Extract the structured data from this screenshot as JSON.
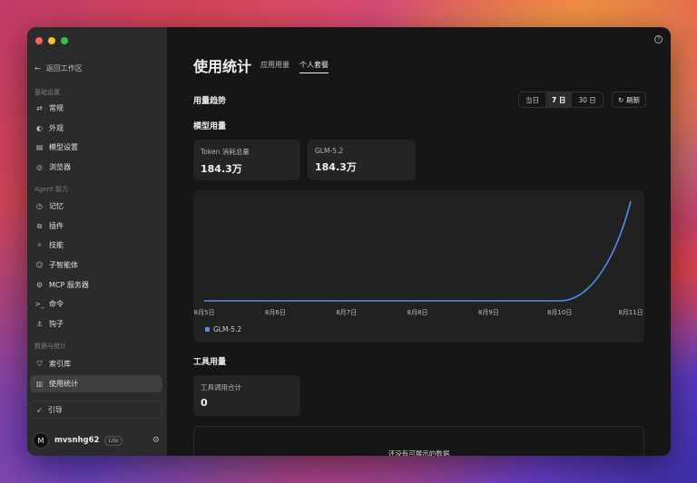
{
  "sidebar": {
    "back_label": "返回工作区",
    "section_basic": "基础设置",
    "items_basic": [
      {
        "label": "常规",
        "icon": "sliders-icon"
      },
      {
        "label": "外观",
        "icon": "palette-icon"
      },
      {
        "label": "模型设置",
        "icon": "server-icon"
      },
      {
        "label": "浏览器",
        "icon": "compass-icon"
      }
    ],
    "section_agent": "Agent 能力",
    "items_agent": [
      {
        "label": "记忆",
        "icon": "memory-icon"
      },
      {
        "label": "插件",
        "icon": "plugin-icon"
      },
      {
        "label": "技能",
        "icon": "skill-icon"
      },
      {
        "label": "子智能体",
        "icon": "bot-icon"
      },
      {
        "label": "MCP 服务器",
        "icon": "mcp-icon"
      },
      {
        "label": "命令",
        "icon": "terminal-icon"
      },
      {
        "label": "钩子",
        "icon": "anchor-icon"
      }
    ],
    "section_data": "数据与统计",
    "items_data": [
      {
        "label": "索引库",
        "icon": "shield-icon"
      },
      {
        "label": "使用统计",
        "icon": "bar-chart-icon"
      }
    ],
    "guide_label": "引导",
    "user": {
      "avatar": "M",
      "name": "mvsnhg62",
      "badge": "Lite"
    }
  },
  "main": {
    "title": "使用统计",
    "tabs": [
      "应用用量",
      "个人套餐"
    ],
    "active_tab": 1,
    "trend_heading": "用量趋势",
    "ranges": [
      "当日",
      "7 日",
      "30 日"
    ],
    "selected_range": 1,
    "refresh_label": "刷新",
    "model_heading": "模型用量",
    "model_cards": [
      {
        "label": "Token 消耗总量",
        "value": "184.3万"
      },
      {
        "label": "GLM-5.2",
        "value": "184.3万"
      }
    ],
    "tool_heading": "工具用量",
    "tool_card": {
      "label": "工具调用合计",
      "value": "0"
    },
    "empty_text": "还没有可展示的数据"
  },
  "chart_data": {
    "type": "line",
    "categories": [
      "8月5日",
      "8月6日",
      "8月7日",
      "8月8日",
      "8月9日",
      "8月10日",
      "8月11日"
    ],
    "series": [
      {
        "name": "GLM-5.2",
        "values": [
          0,
          0,
          0,
          0,
          0,
          0,
          1843000
        ],
        "color": "#4f8cf5"
      }
    ],
    "legend": "bottom-left",
    "grid": false
  }
}
